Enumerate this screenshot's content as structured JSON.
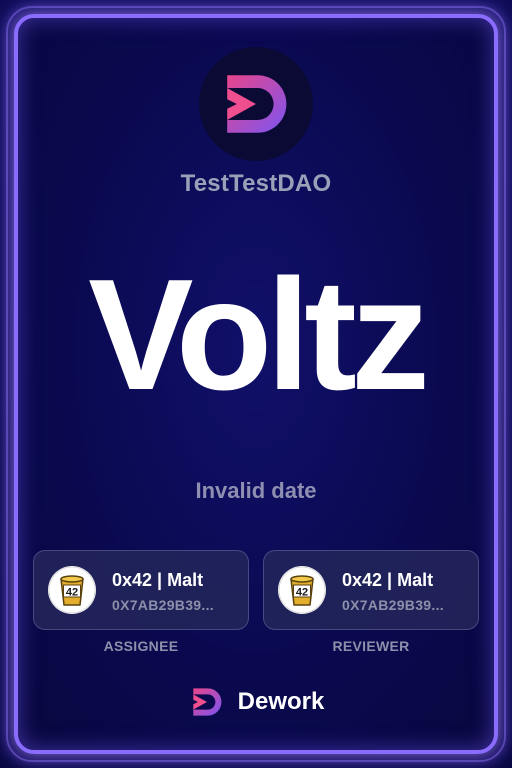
{
  "organization": {
    "name": "TestTestDAO",
    "logo_icon": "dework-logo-icon"
  },
  "task": {
    "title": "Voltz",
    "date": "Invalid date"
  },
  "assignee": {
    "name": "0x42 | Malt",
    "address": "0X7AB29B39...",
    "role": "ASSIGNEE",
    "avatar_text": "42",
    "avatar_icon": "trash-can-avatar-icon"
  },
  "reviewer": {
    "name": "0x42 | Malt",
    "address": "0X7AB29B39...",
    "role": "REVIEWER",
    "avatar_text": "42",
    "avatar_icon": "trash-can-avatar-icon"
  },
  "brand": {
    "name": "Dework",
    "logo_icon": "dework-logo-icon"
  },
  "colors": {
    "background": "#0b0a4a",
    "frame": "#8a6cff",
    "logo_gradient_start": "#e0407c",
    "logo_gradient_end": "#7b55f0",
    "text_muted": "#8d90aa"
  }
}
